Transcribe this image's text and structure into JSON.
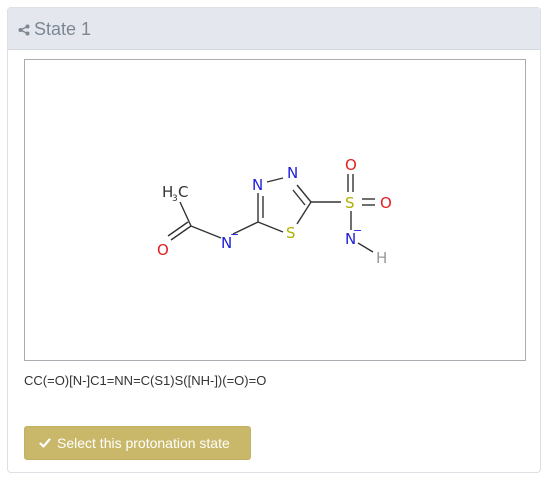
{
  "panel": {
    "title": "State 1",
    "title_icon": "share-icon"
  },
  "molecule": {
    "atoms": {
      "methyl": "H",
      "methyl_sub": "3",
      "methyl_c": "C",
      "carbonyl_o": "O",
      "amide_n": "N",
      "amide_n_charge": "−",
      "ring_n1": "N",
      "ring_n2": "N",
      "ring_s": "S",
      "sulfonyl_s": "S",
      "sulfonyl_o_top": "O",
      "sulfonyl_o_right": "O",
      "sulfonamide_n": "N",
      "sulfonamide_n_charge": "−",
      "sulfonamide_h": "H"
    },
    "colors": {
      "carbon": "#333333",
      "nitrogen": "#2020d8",
      "oxygen": "#e02020",
      "sulfur": "#b0b000",
      "hydrogen": "#999999"
    }
  },
  "smiles": "CC(=O)[N-]C1=NN=C(S1)S([NH-])(=O)=O",
  "select_button": {
    "label": "Select this protonation state",
    "icon": "check-icon",
    "color": "#c9b86a"
  }
}
